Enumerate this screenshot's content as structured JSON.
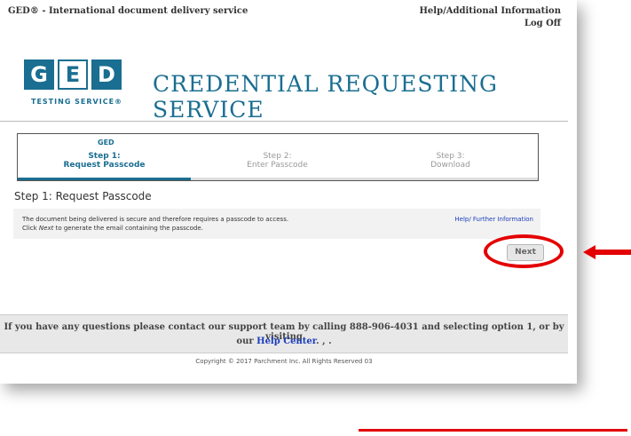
{
  "header": {
    "site_title": "GED® - International document delivery service",
    "help_link": "Help/Additional Information",
    "logoff_link": "Log Off"
  },
  "brand": {
    "logo_letters": [
      "G",
      "E",
      "D"
    ],
    "logo_tagline": "TESTING SERVICE®",
    "service_title": "CREDENTIAL REQUESTING SERVICE",
    "accent_color": "#1a6e91"
  },
  "stepper": {
    "steps": [
      {
        "num": "Step 1:",
        "name": "Request Passcode",
        "active": true
      },
      {
        "num": "Step 2:",
        "name": "Enter Passcode",
        "active": false
      },
      {
        "num": "Step 3:",
        "name": "Download",
        "active": false
      }
    ],
    "active_icon": "GED"
  },
  "main": {
    "heading": "Step 1: Request Passcode",
    "info_line1": "The document being delivered is secure and therefore requires a passcode to access.",
    "info_line2_prefix": "Click ",
    "info_line2_em": "Next",
    "info_line2_suffix": " to generate the email containing the passcode.",
    "help_further": "Help/ Further Information",
    "next_button": "Next"
  },
  "footer": {
    "support_line1": "If you have any questions please contact our support team by calling 888-906-4031 and selecting option 1, or by visiting",
    "support_line2_prefix": "our ",
    "support_link": "Help Center",
    "support_line2_suffix": ". , .",
    "copyright": "Copyright © 2017 Parchment Inc. All Rights Reserved 03"
  },
  "annotation": {
    "highlight_color": "#e40000"
  }
}
